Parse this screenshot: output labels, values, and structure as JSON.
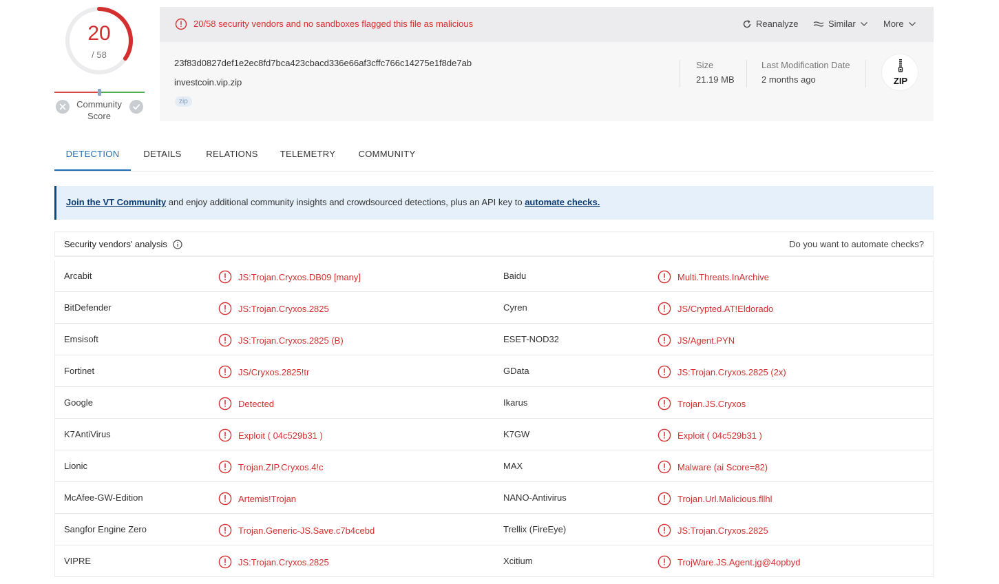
{
  "score": {
    "detected": "20",
    "total": "/ 58",
    "fraction": 0.345
  },
  "community": {
    "label_line1": "Community",
    "label_line2": "Score"
  },
  "alert": {
    "text": "20/58 security vendors and no sandboxes flagged this file as malicious"
  },
  "actions": {
    "reanalyze": "Reanalyze",
    "similar": "Similar",
    "more": "More"
  },
  "file": {
    "hash": "23f83d0827def1e2ec8fd7bca423cbacd336e66af3cffc766c14275e1f8de7ab",
    "name": "investcoin.vip.zip",
    "tag": "zip",
    "size_label": "Size",
    "size_value": "21.19 MB",
    "date_label": "Last Modification Date",
    "date_value": "2 months ago",
    "type_icon_text": "ZIP"
  },
  "tabs": [
    {
      "label": "DETECTION",
      "active": true
    },
    {
      "label": "DETAILS",
      "active": false
    },
    {
      "label": "RELATIONS",
      "active": false
    },
    {
      "label": "TELEMETRY",
      "active": false
    },
    {
      "label": "COMMUNITY",
      "active": false
    }
  ],
  "banner": {
    "link1": "Join the VT Community",
    "middle": " and enjoy additional community insights and crowdsourced detections, plus an API key to ",
    "link2": "automate checks."
  },
  "vendors_header": {
    "title": "Security vendors' analysis",
    "right": "Do you want to automate checks?"
  },
  "colors": {
    "malicious": "#d32f2f",
    "accent": "#1f6db5",
    "banner_border": "#0b4a85"
  },
  "vendors": [
    {
      "left_name": "Arcabit",
      "left_result": "JS:Trojan.Cryxos.DB09 [many]",
      "right_name": "Baidu",
      "right_result": "Multi.Threats.InArchive"
    },
    {
      "left_name": "BitDefender",
      "left_result": "JS:Trojan.Cryxos.2825",
      "right_name": "Cyren",
      "right_result": "JS/Crypted.AT!Eldorado"
    },
    {
      "left_name": "Emsisoft",
      "left_result": "JS:Trojan.Cryxos.2825 (B)",
      "right_name": "ESET-NOD32",
      "right_result": "JS/Agent.PYN"
    },
    {
      "left_name": "Fortinet",
      "left_result": "JS/Cryxos.2825!tr",
      "right_name": "GData",
      "right_result": "JS:Trojan.Cryxos.2825 (2x)"
    },
    {
      "left_name": "Google",
      "left_result": "Detected",
      "right_name": "Ikarus",
      "right_result": "Trojan.JS.Cryxos"
    },
    {
      "left_name": "K7AntiVirus",
      "left_result": "Exploit ( 04c529b31 )",
      "right_name": "K7GW",
      "right_result": "Exploit ( 04c529b31 )"
    },
    {
      "left_name": "Lionic",
      "left_result": "Trojan.ZIP.Cryxos.4!c",
      "right_name": "MAX",
      "right_result": "Malware (ai Score=82)"
    },
    {
      "left_name": "McAfee-GW-Edition",
      "left_result": "Artemis!Trojan",
      "right_name": "NANO-Antivirus",
      "right_result": "Trojan.Url.Malicious.fllhl"
    },
    {
      "left_name": "Sangfor Engine Zero",
      "left_result": "Trojan.Generic-JS.Save.c7b4cebd",
      "right_name": "Trellix (FireEye)",
      "right_result": "JS:Trojan.Cryxos.2825"
    },
    {
      "left_name": "VIPRE",
      "left_result": "JS:Trojan.Cryxos.2825",
      "right_name": "Xcitium",
      "right_result": "TrojWare.JS.Agent.jg@4opbyd"
    }
  ]
}
